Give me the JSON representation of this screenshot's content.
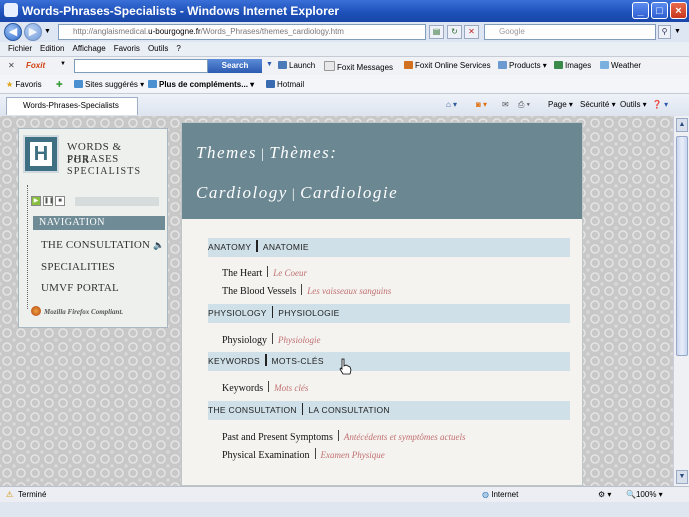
{
  "window": {
    "title": "Words-Phrases-Specialists - Windows Internet Explorer"
  },
  "address": {
    "url_prefix": "http://anglaismedical.",
    "url_domain": "u-bourgogne.fr",
    "url_path": "/Words_Phrases/themes_cardiology.htm",
    "search_placeholder": "Google"
  },
  "menu": [
    "Fichier",
    "Edition",
    "Affichage",
    "Favoris",
    "Outils",
    "?"
  ],
  "foxit_toolbar": {
    "brand": "Foxit",
    "search_button": "Search",
    "items": [
      "Launch",
      "Foxit Messages",
      "Foxit Online Services",
      "Products",
      "Images",
      "Weather"
    ]
  },
  "favorites": {
    "label": "Favoris",
    "items": [
      "Sites suggérés",
      "Plus de compléments...",
      "Hotmail"
    ]
  },
  "tab": {
    "title": "Words-Phrases-Specialists"
  },
  "command_bar": [
    "Page",
    "Sécurité",
    "Outils"
  ],
  "sidebar": {
    "logo_letter": "H",
    "title_line1": "WORDS & PHRASES",
    "title_line2": "FOR SPECIALISTS",
    "nav_header": "NAVIGATION",
    "nav_items": [
      "THE CONSULTATION",
      "SPECIALITIES",
      "UMVF PORTAL"
    ],
    "firefox_note": "Mozilla Firefox Compliant."
  },
  "banner": {
    "line1_en": "Themes",
    "line1_fr": "Thèmes:",
    "line2_en": "Cardiology",
    "line2_fr": "Cardiologie"
  },
  "sections": [
    {
      "en": "ANATOMY",
      "fr": "ANATOMIE",
      "rows": [
        {
          "en": "The Heart",
          "fr": "Le Coeur"
        },
        {
          "en": "The Blood Vessels",
          "fr": "Les vaisseaux sanguins"
        }
      ]
    },
    {
      "en": "PHYSIOLOGY",
      "fr": "PHYSIOLOGIE",
      "rows": [
        {
          "en": "Physiology",
          "fr": "Physiologie"
        }
      ]
    },
    {
      "en": "KEYWORDS",
      "fr": "MOTS-CLÉS",
      "rows": [
        {
          "en": "Keywords",
          "fr": "Mots clés"
        }
      ]
    },
    {
      "en": "THE CONSULTATION",
      "fr": "LA CONSULTATION",
      "rows": [
        {
          "en": "Past and Present Symptoms",
          "fr": "Antécédents et symptômes actuels"
        },
        {
          "en": "Physical Examination",
          "fr": "Examen Physique"
        }
      ]
    }
  ],
  "status": {
    "text": "Terminé",
    "zone": "Internet",
    "zoom": "100%"
  }
}
